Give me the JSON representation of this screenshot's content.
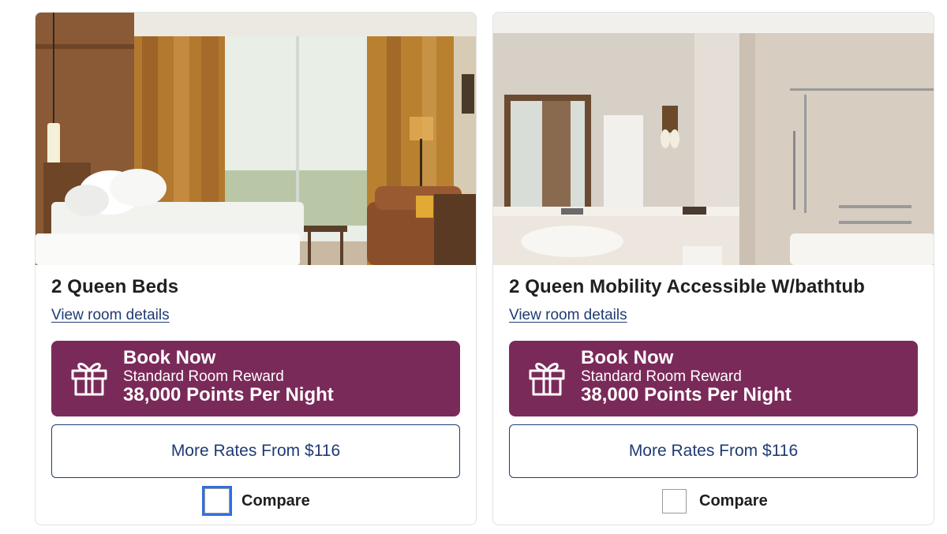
{
  "rooms": [
    {
      "title": "2 Queen Beds",
      "details_link": "View room details",
      "book": {
        "title": "Book Now",
        "subtitle": "Standard Room Reward",
        "points": "38,000 Points Per Night"
      },
      "more_rates": "More Rates From $116",
      "compare_label": "Compare",
      "compare_checked": false,
      "compare_focused": true
    },
    {
      "title": "2 Queen Mobility Accessible W/bathtub",
      "details_link": "View room details",
      "book": {
        "title": "Book Now",
        "subtitle": "Standard Room Reward",
        "points": "38,000 Points Per Night"
      },
      "more_rates": "More Rates From $116",
      "compare_label": "Compare",
      "compare_checked": false,
      "compare_focused": false
    }
  ],
  "colors": {
    "book_button": "#7a2a59",
    "link": "#1f3b73",
    "focus_ring": "#2f6fe0"
  },
  "icons": {
    "book_button_icon": "gift-icon"
  }
}
